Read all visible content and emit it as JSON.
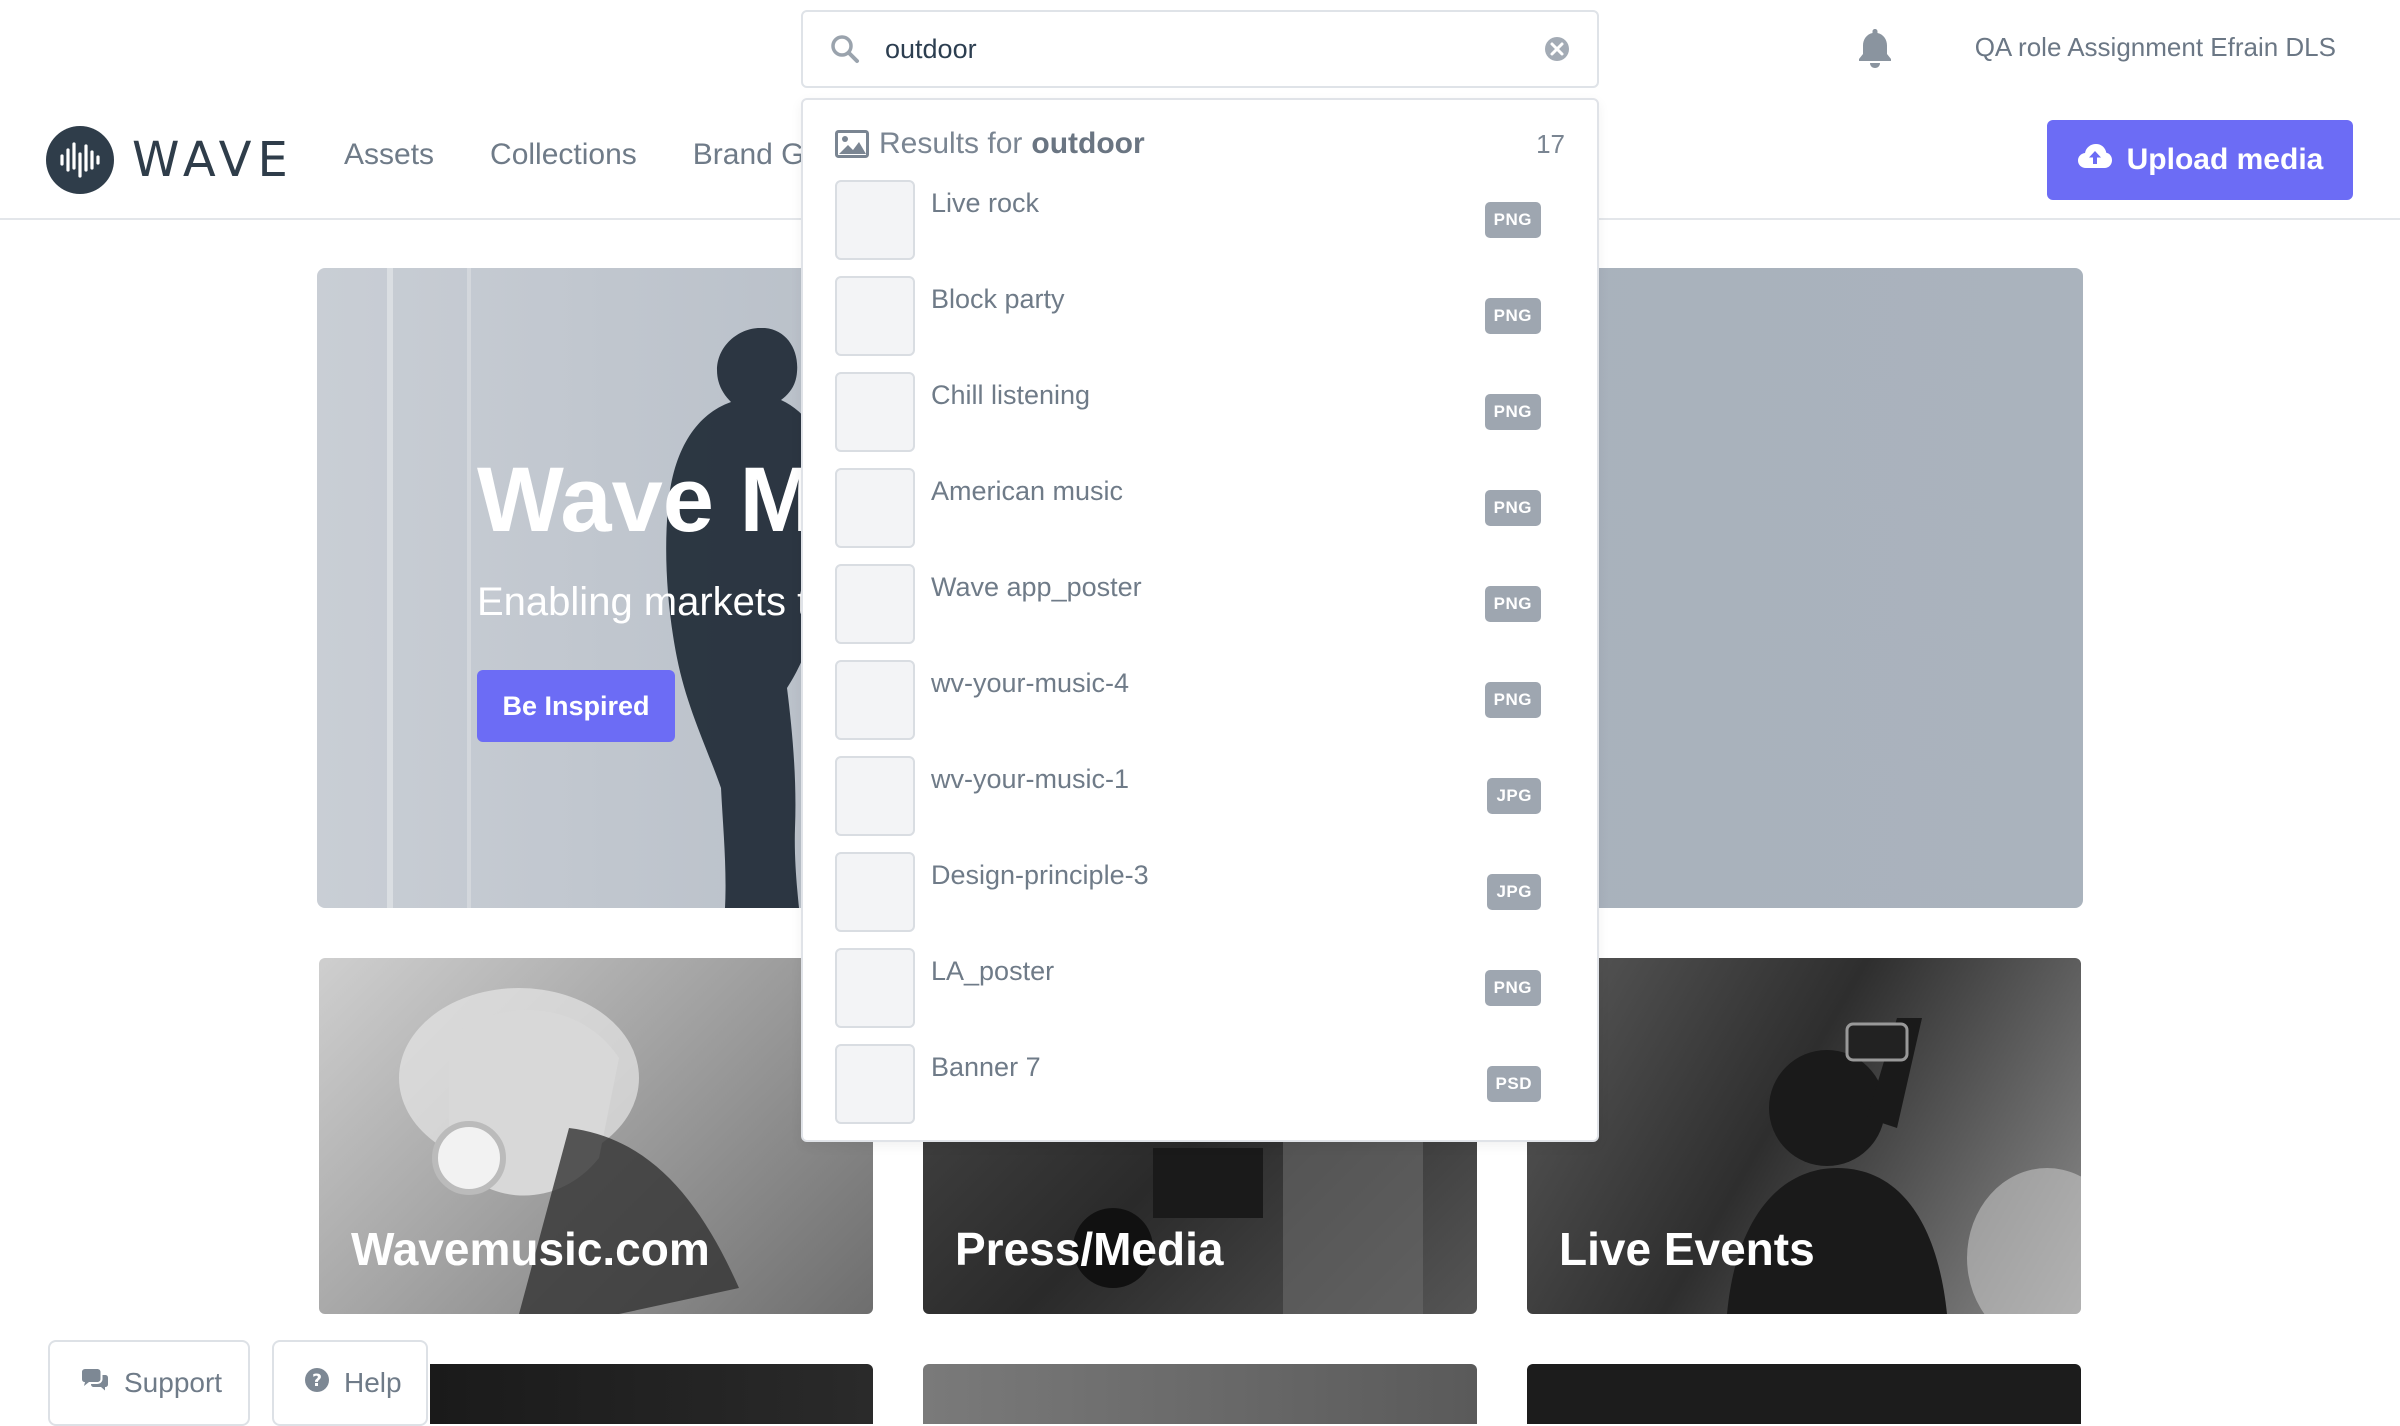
{
  "search": {
    "value": "outdoor",
    "placeholder": "Search"
  },
  "header": {
    "user_name": "QA role Assignment Efrain DLS",
    "logo_text": "WAVE",
    "nav": [
      "Assets",
      "Collections",
      "Brand G"
    ],
    "upload_label": "Upload media"
  },
  "hero": {
    "title": "Wave Ma",
    "subtitle": "Enabling markets t",
    "button_label": "Be Inspired"
  },
  "cards": [
    {
      "label": "Wavemusic.com"
    },
    {
      "label": "Press/Media"
    },
    {
      "label": "Live Events"
    }
  ],
  "footer_buttons": {
    "support": "Support",
    "help": "Help"
  },
  "dropdown": {
    "results_prefix": "Results for",
    "query": "outdoor",
    "count": "17",
    "items": [
      {
        "name": "Live rock",
        "type": "PNG"
      },
      {
        "name": "Block party",
        "type": "PNG"
      },
      {
        "name": "Chill listening",
        "type": "PNG"
      },
      {
        "name": "American music",
        "type": "PNG"
      },
      {
        "name": "Wave app_poster",
        "type": "PNG"
      },
      {
        "name": "wv-your-music-4",
        "type": "PNG"
      },
      {
        "name": "wv-your-music-1",
        "type": "JPG"
      },
      {
        "name": "Design-principle-3",
        "type": "JPG"
      },
      {
        "name": "LA_poster",
        "type": "PNG"
      },
      {
        "name": "Banner 7",
        "type": "PSD"
      }
    ]
  },
  "colors": {
    "accent": "#6c6cf5",
    "text_muted": "#6f7b88",
    "badge": "#9ea6b0",
    "logo": "#2f3d4a"
  },
  "icons": {
    "search": "search-icon",
    "clear": "clear-icon",
    "bell": "bell-icon",
    "upload": "cloud-upload-icon",
    "image": "image-icon",
    "support": "chat-bubbles-icon",
    "help": "question-circle-icon"
  }
}
